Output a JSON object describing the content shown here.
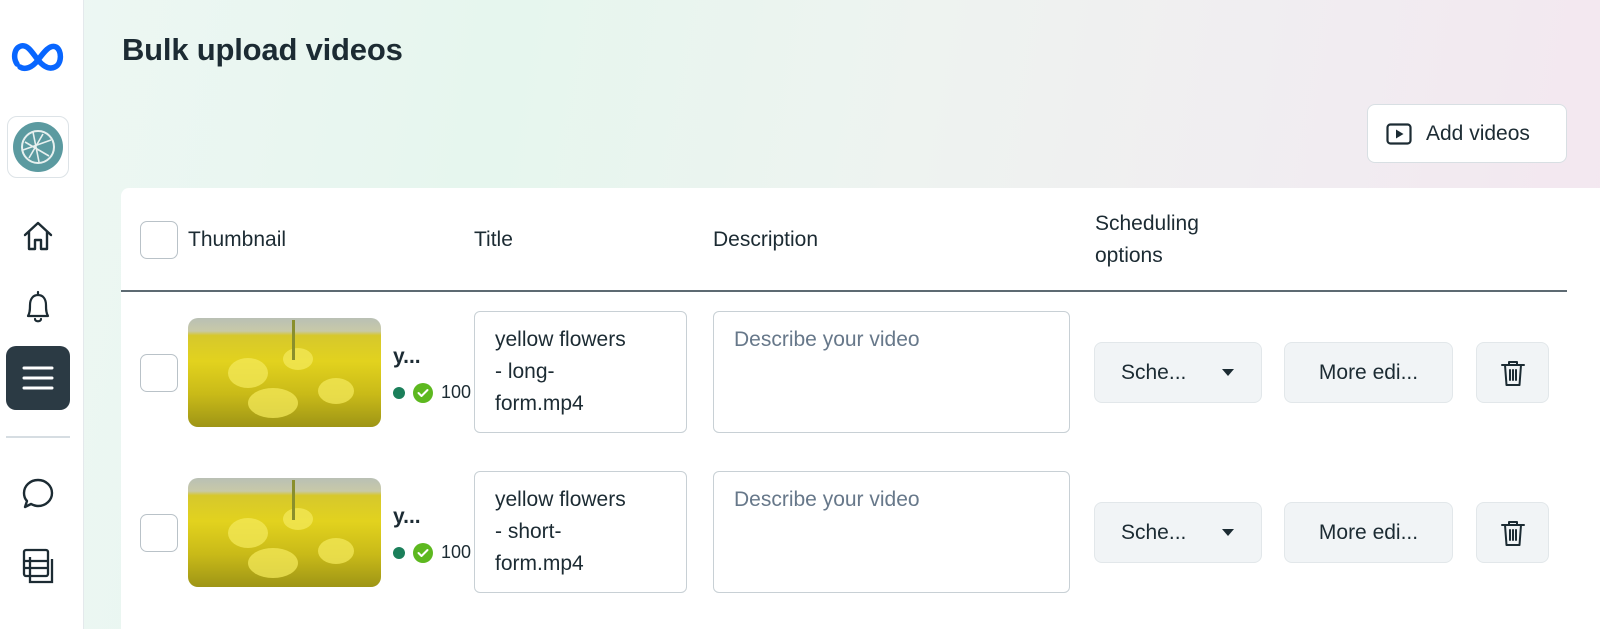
{
  "page": {
    "title": "Bulk upload videos"
  },
  "toolbar": {
    "add_videos_label": "Add videos"
  },
  "sidebar": {
    "icons": [
      "meta-logo",
      "account-avatar",
      "home-icon",
      "bell-icon",
      "menu-icon",
      "chat-icon",
      "pages-icon"
    ]
  },
  "table": {
    "headers": {
      "thumbnail": "Thumbnail",
      "title": "Title",
      "description": "Description",
      "scheduling_line1": "Scheduling",
      "scheduling_line2": "options"
    },
    "rows": [
      {
        "filename_short": "y...",
        "status_percent": "100",
        "title_lines": [
          "yellow flowers",
          "- long-",
          "form.mp4"
        ],
        "description_placeholder": "Describe your video",
        "schedule_label": "Sche...",
        "more_label": "More edi..."
      },
      {
        "filename_short": "y...",
        "status_percent": "100",
        "title_lines": [
          "yellow flowers",
          "- short-",
          "form.mp4"
        ],
        "description_placeholder": "Describe your video",
        "schedule_label": "Sche...",
        "more_label": "More edi..."
      }
    ]
  },
  "colors": {
    "meta_blue": "#0866ff",
    "menu_active_bg": "#2b3a44",
    "status_dot": "#1b7f5a",
    "status_check": "#5db81f"
  }
}
